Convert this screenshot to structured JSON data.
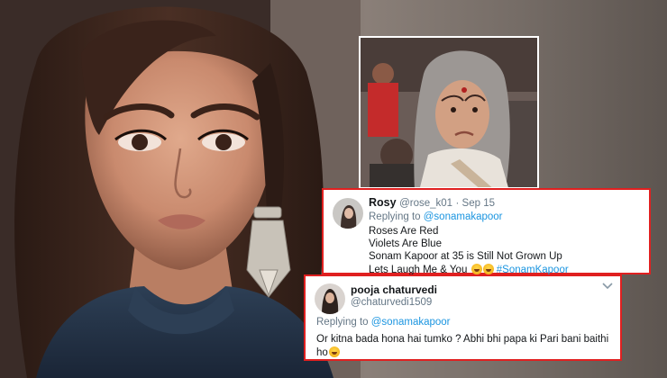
{
  "tweet_rosy": {
    "name": "Rosy",
    "handle": "@rose_k01",
    "date": "· Sep 15",
    "replying_prefix": "Replying to",
    "replying_mention": "@sonamakapoor",
    "lines": [
      "Roses Are Red",
      "Violets Are Blue",
      "Sonam Kapoor at 35 is Still Not Grown Up",
      "Lets Laugh Me & You"
    ],
    "emoji_icon": "laughing-tears-emoji",
    "hashtag": "#SonamKapoor"
  },
  "tweet_pooja": {
    "name": "pooja chaturvedi",
    "handle": "@chaturvedi1509",
    "replying_prefix": "Replying to",
    "replying_mention": "@sonamakapoor",
    "line1": "Or kitna bada hona hai tumko ? Abhi bhi papa ki Pari bani baithi",
    "line2": "ho",
    "emoji_icon": "laughing-tears-emoji",
    "menu_icon": "chevron-down-icon"
  },
  "colors": {
    "card_border": "#e02020",
    "link_blue": "#1b95e0",
    "muted_gray": "#657786",
    "text_dark": "#14171a"
  }
}
